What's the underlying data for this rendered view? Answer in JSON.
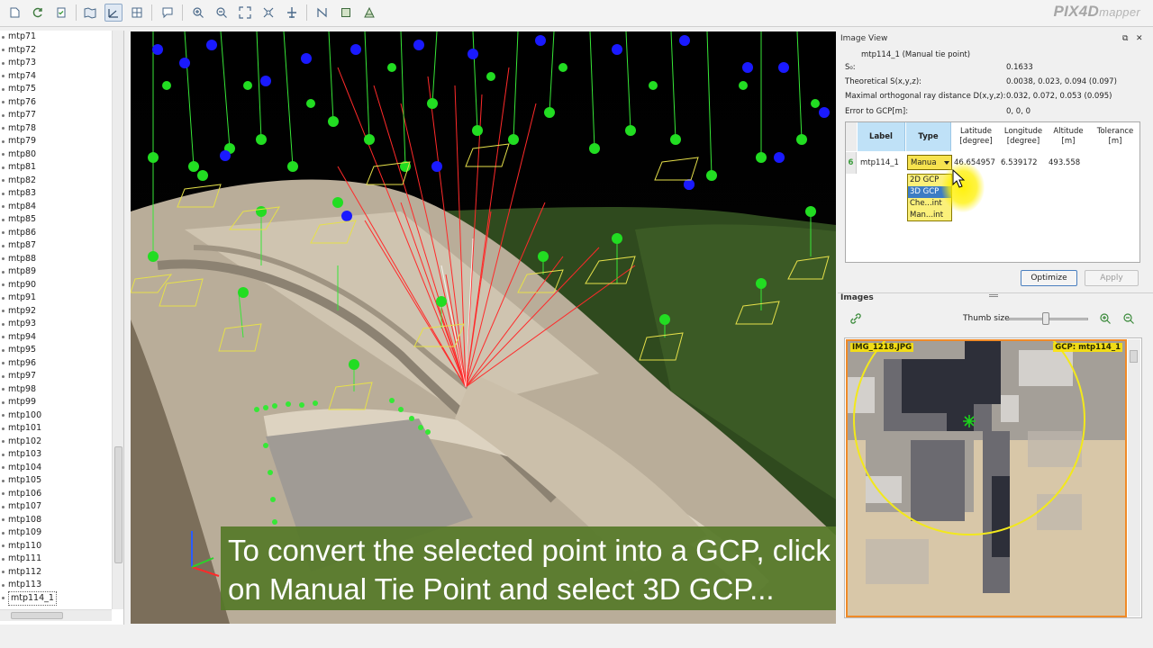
{
  "app": {
    "logo_main": "PIX4D",
    "logo_sub": "mapper"
  },
  "toolbar": {
    "buttons": [
      "new-project-icon",
      "refresh-icon",
      "checklist-icon",
      "map-view-icon",
      "ray-cloud-icon",
      "mosaic-editor-icon",
      "comment-icon",
      "zoom-in-icon",
      "zoom-out-icon",
      "zoom-extent-icon",
      "fit-selection-icon",
      "flight-icon",
      "measure-polyline-icon",
      "measure-surface-icon",
      "volume-icon"
    ],
    "active": "ray-cloud-icon"
  },
  "tree": {
    "items": [
      "mtp71",
      "mtp72",
      "mtp73",
      "mtp74",
      "mtp75",
      "mtp76",
      "mtp77",
      "mtp78",
      "mtp79",
      "mtp80",
      "mtp81",
      "mtp82",
      "mtp83",
      "mtp84",
      "mtp85",
      "mtp86",
      "mtp87",
      "mtp88",
      "mtp89",
      "mtp90",
      "mtp91",
      "mtp92",
      "mtp93",
      "mtp94",
      "mtp95",
      "mtp96",
      "mtp97",
      "mtp98",
      "mtp99",
      "mtp100",
      "mtp101",
      "mtp102",
      "mtp103",
      "mtp104",
      "mtp105",
      "mtp106",
      "mtp107",
      "mtp108",
      "mtp109",
      "mtp110",
      "mtp111",
      "mtp112",
      "mtp113",
      "mtp114_1"
    ],
    "selected": "mtp114_1"
  },
  "caption": {
    "line1": "To convert the selected point into a GCP, click",
    "line2": "on Manual Tie Point and select 3D GCP..."
  },
  "image_view": {
    "title": "Image View",
    "point_title": "mtp114_1 (Manual tie point)",
    "rows": [
      {
        "label": "S₀:",
        "value": "0.1633"
      },
      {
        "label": "Theoretical S(x,y,z):",
        "value": "0.0038, 0.023, 0.094 (0.097)"
      },
      {
        "label": "Maximal orthogonal ray distance D(x,y,z):",
        "value": "0.032, 0.072, 0.053 (0.095)"
      },
      {
        "label": "Error to GCP[m]:",
        "value": "0, 0, 0"
      }
    ],
    "table": {
      "headers": {
        "label": "Label",
        "type": "Type",
        "lat1": "Latitude",
        "lat2": "[degree]",
        "lon1": "Longitude",
        "lon2": "[degree]",
        "alt1": "Altitude",
        "alt2": "[m]",
        "tol1": "Tolerance",
        "tol2": "[m]"
      },
      "row": {
        "index": "6",
        "label": "mtp114_1",
        "type": "Manua",
        "latitude": "46.654957",
        "longitude": "6.539172",
        "altitude": "493.558"
      },
      "type_options": [
        "2D GCP",
        "3D GCP",
        "Che...int",
        "Man...int"
      ],
      "type_selected": "3D GCP"
    },
    "buttons": {
      "optimize": "Optimize",
      "apply": "Apply"
    }
  },
  "images": {
    "title": "Images",
    "thumb_size_label": "Thumb size",
    "thumb_size_fraction": 0.47,
    "thumbnail": {
      "image_name": "IMG_1218.JPG",
      "gcp_label": "GCP: mtp114_1"
    }
  },
  "colors": {
    "accent_selection": "#3c7cc4",
    "dropdown_bg": "#f7e34f",
    "caption_bg": "#557828",
    "thumb_border": "#f08a27",
    "camera_green": "#22dd22",
    "camera_blue": "#1a1aff",
    "ray_red": "#ff2020"
  }
}
